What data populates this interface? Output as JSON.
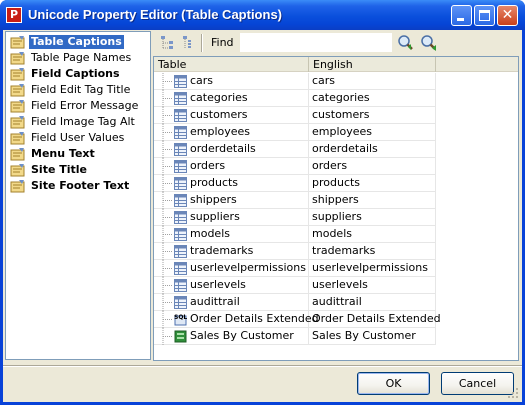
{
  "window": {
    "title": "Unicode Property Editor (Table Captions)",
    "app_icon_letter": "P"
  },
  "sidebar": {
    "items": [
      {
        "label": "Table Captions",
        "bold": true,
        "selected": true
      },
      {
        "label": "Table Page Names",
        "bold": false,
        "selected": false
      },
      {
        "label": "Field Captions",
        "bold": true,
        "selected": false
      },
      {
        "label": "Field Edit Tag Title",
        "bold": false,
        "selected": false
      },
      {
        "label": "Field Error Message",
        "bold": false,
        "selected": false
      },
      {
        "label": "Field Image Tag Alt",
        "bold": false,
        "selected": false
      },
      {
        "label": "Field User Values",
        "bold": false,
        "selected": false
      },
      {
        "label": "Menu Text",
        "bold": true,
        "selected": false
      },
      {
        "label": "Site Title",
        "bold": true,
        "selected": false
      },
      {
        "label": "Site Footer Text",
        "bold": true,
        "selected": false
      }
    ]
  },
  "toolbar": {
    "expand_icon": "expand-tree-icon",
    "collapse_icon": "collapse-tree-icon",
    "find_label": "Find",
    "find_value": "",
    "find_next_icon": "find-next-icon",
    "find_prev_icon": "find-previous-icon"
  },
  "grid": {
    "columns": [
      "Table",
      "English"
    ],
    "rows": [
      {
        "table": "cars",
        "english": "cars",
        "icon": "table-icon"
      },
      {
        "table": "categories",
        "english": "categories",
        "icon": "table-icon"
      },
      {
        "table": "customers",
        "english": "customers",
        "icon": "table-icon"
      },
      {
        "table": "employees",
        "english": "employees",
        "icon": "table-icon"
      },
      {
        "table": "orderdetails",
        "english": "orderdetails",
        "icon": "table-icon"
      },
      {
        "table": "orders",
        "english": "orders",
        "icon": "table-icon"
      },
      {
        "table": "products",
        "english": "products",
        "icon": "table-icon"
      },
      {
        "table": "shippers",
        "english": "shippers",
        "icon": "table-icon"
      },
      {
        "table": "suppliers",
        "english": "suppliers",
        "icon": "table-icon"
      },
      {
        "table": "models",
        "english": "models",
        "icon": "table-icon"
      },
      {
        "table": "trademarks",
        "english": "trademarks",
        "icon": "table-icon"
      },
      {
        "table": "userlevelpermissions",
        "english": "userlevelpermissions",
        "icon": "table-icon"
      },
      {
        "table": "userlevels",
        "english": "userlevels",
        "icon": "table-icon"
      },
      {
        "table": "audittrail",
        "english": "audittrail",
        "icon": "table-icon"
      },
      {
        "table": "Order Details Extended",
        "english": "Order Details Extended",
        "icon": "sql-view-icon",
        "icon_text": "SQL"
      },
      {
        "table": "Sales By Customer",
        "english": "Sales By Customer",
        "icon": "report-icon"
      }
    ]
  },
  "buttons": {
    "ok": "OK",
    "cancel": "Cancel"
  },
  "colors": {
    "titlebar": "#0a4fdc",
    "selection": "#316ac5",
    "dialog_face": "#ece9d8"
  }
}
